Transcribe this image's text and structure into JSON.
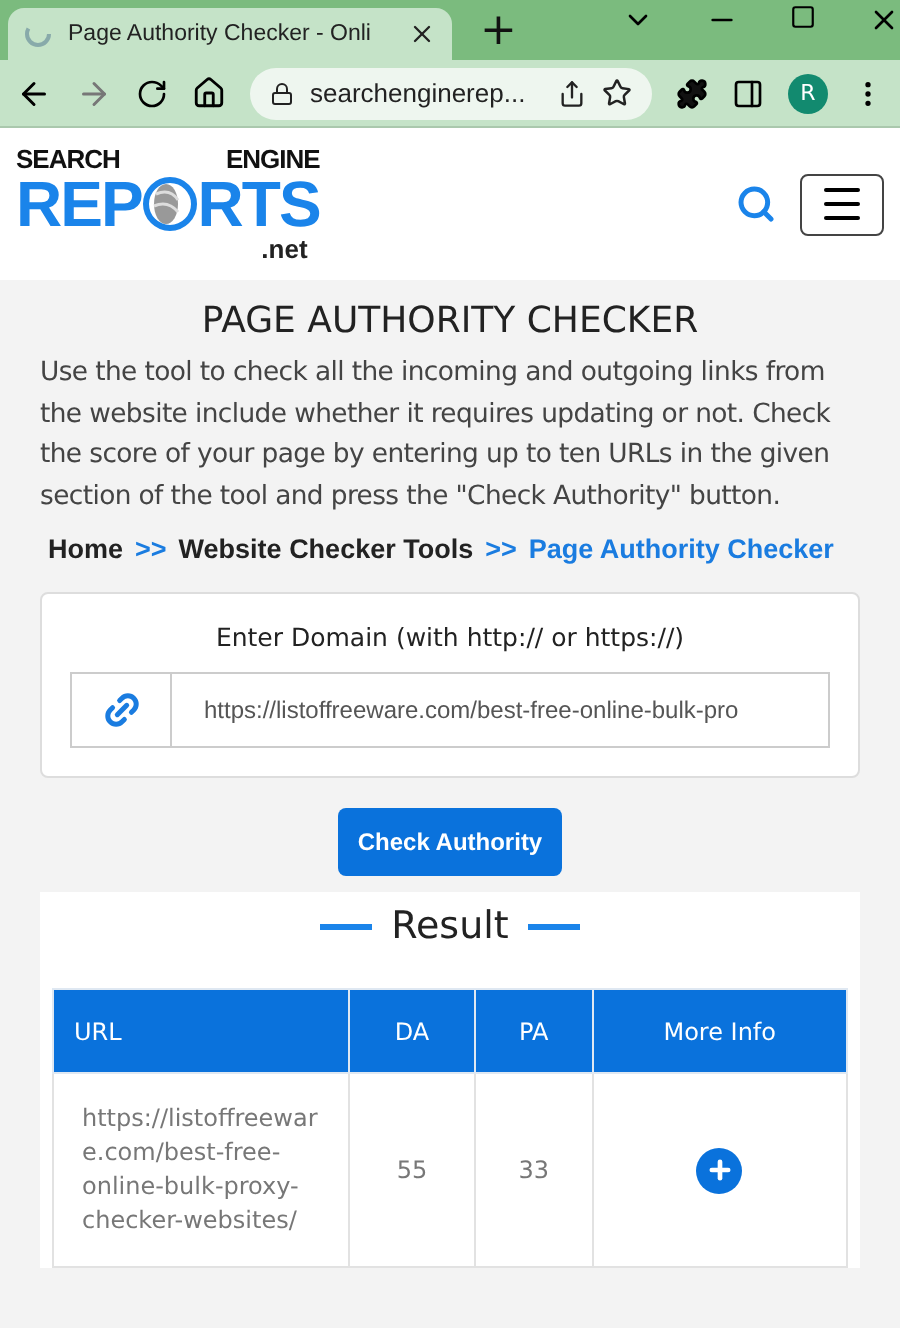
{
  "browser": {
    "tab_title": "Page Authority Checker - Onli",
    "new_tab": "+",
    "address": "searchenginerep...",
    "profile": "R"
  },
  "logo": {
    "top_left": "SEARCH",
    "top_right": "ENGINE",
    "main_left": "REP",
    "main_right": "RTS",
    "suffix": ".net"
  },
  "page": {
    "title": "PAGE AUTHORITY CHECKER",
    "description": "Use the tool to check all the incoming and outgoing links from the website include whether it requires updating or not. Check the score of your page by entering up to ten URLs in the given section of the tool and press the \"Check Authority\" button.",
    "breadcrumbs": [
      {
        "label": "Home",
        "current": false
      },
      {
        "label": "Website Checker Tools",
        "current": false
      },
      {
        "label": "Page Authority Checker",
        "current": true
      }
    ],
    "separator": ">>"
  },
  "form": {
    "label": "Enter Domain (with http:// or https://)",
    "value": "https://listoffreeware.com/best-free-online-bulk-pro",
    "button": "Check Authority"
  },
  "result": {
    "title": "Result",
    "columns": [
      "URL",
      "DA",
      "PA",
      "More Info"
    ],
    "rows": [
      {
        "url": "https://listoffreeware.com/best-free-online-bulk-proxy-checker-websites/",
        "da": "55",
        "pa": "33"
      }
    ]
  }
}
